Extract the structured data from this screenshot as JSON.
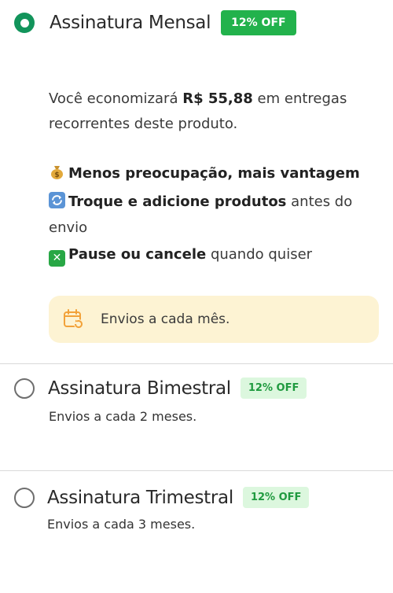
{
  "plans": [
    {
      "title": "Assinatura Mensal",
      "badge": "12% OFF",
      "selected": true,
      "savings_prefix": "Você economizará",
      "savings_amount": "R$ 55,88",
      "savings_suffix": "em entregas recorrentes deste produto.",
      "benefits": [
        {
          "icon": "money-bag-icon",
          "bold": "Menos preocupação, mais vantagem",
          "rest": ""
        },
        {
          "icon": "refresh-icon",
          "bold": "Troque e adicione produtos",
          "rest": "antes do envio"
        },
        {
          "icon": "cross-icon",
          "bold": "Pause ou cancele",
          "rest": "quando quiser"
        }
      ],
      "info": {
        "icon": "calendar-repeat-icon",
        "text": "Envios a cada mês."
      }
    },
    {
      "title": "Assinatura Bimestral",
      "badge": "12% OFF",
      "selected": false,
      "description": "Envios a cada 2 meses."
    },
    {
      "title": "Assinatura Trimestral",
      "badge": "12% OFF",
      "selected": false,
      "description": "Envios a cada 3 meses."
    }
  ],
  "colors": {
    "primary_green": "#12945b",
    "badge_green": "#22b24c",
    "badge_soft_bg": "#dcf7de",
    "info_bg": "#fdf3d3",
    "calendar_icon": "#f2a23a"
  }
}
